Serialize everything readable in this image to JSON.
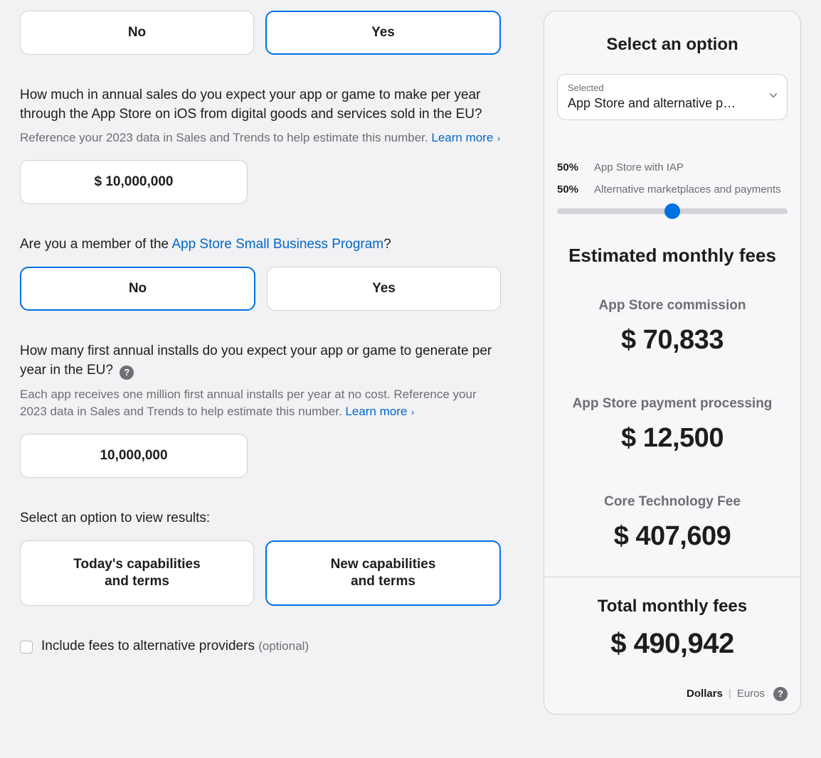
{
  "q1": {
    "no": "No",
    "yes": "Yes"
  },
  "salesQ": {
    "text": "How much in annual sales do you expect your app or game to make per year through the App Store on iOS from digital goods and services sold in the EU?",
    "sub": "Reference your 2023 data in Sales and Trends to help estimate this number. ",
    "learn": "Learn more",
    "value": "$ 10,000,000"
  },
  "sbp": {
    "prefix": "Are you a member of the ",
    "link": "App Store Small Business Program",
    "suffix": "?",
    "no": "No",
    "yes": "Yes"
  },
  "installs": {
    "text": "How many first annual installs do you expect your app or game to generate per year in the EU?",
    "sub": "Each app receives one million first annual installs per year at no cost. Reference your 2023 data in Sales and Trends to help estimate this number. ",
    "learn": "Learn more",
    "value": "10,000,000"
  },
  "viewResults": {
    "text": "Select an option to view results:",
    "opt1a": "Today's capabilities",
    "opt1b": "and terms",
    "opt2a": "New capabilities",
    "opt2b": "and terms"
  },
  "includeFees": {
    "label": "Include fees to alternative providers",
    "optional": "(optional)"
  },
  "side": {
    "title": "Select an option",
    "selectedLabel": "Selected",
    "selectedValue": "App Store and alternative p…",
    "split1pct": "50%",
    "split1lbl": "App Store with IAP",
    "split2pct": "50%",
    "split2lbl": "Alternative marketplaces and payments",
    "estTitle": "Estimated monthly fees",
    "fee1lbl": "App Store commission",
    "fee1val": "$ 70,833",
    "fee2lbl": "App Store payment processing",
    "fee2val": "$ 12,500",
    "fee3lbl": "Core Technology Fee",
    "fee3val": "$ 407,609",
    "totalLbl": "Total monthly fees",
    "totalVal": "$ 490,942",
    "dollars": "Dollars",
    "euros": "Euros"
  }
}
